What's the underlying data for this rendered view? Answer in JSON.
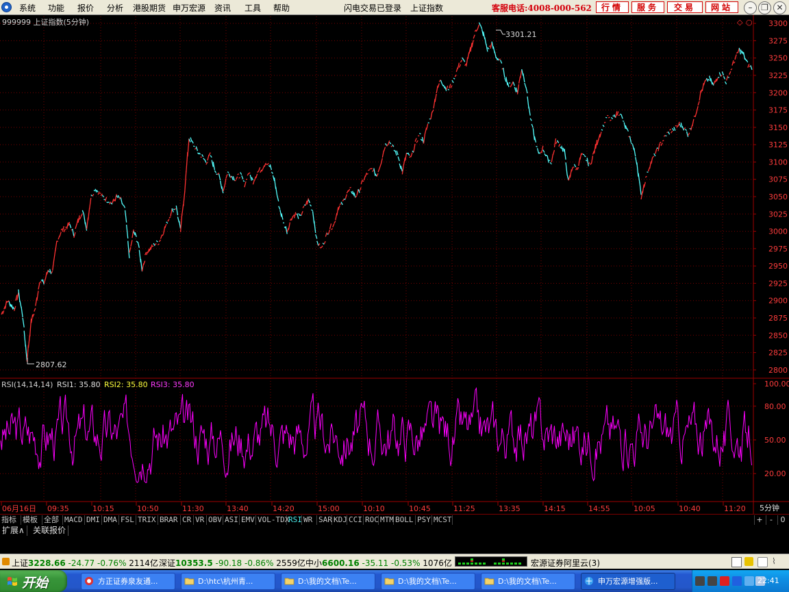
{
  "menubar": {
    "items": [
      "系统",
      "功能",
      "报价",
      "分析",
      "港股期货",
      "申万宏源",
      "资讯",
      "工具",
      "帮助"
    ],
    "status": "闪电交易已登录",
    "index_name": "上证指数",
    "hotline": "客服电话:4008-000-562",
    "buttons": [
      "行情",
      "服务",
      "交易",
      "网站"
    ]
  },
  "chart": {
    "title": "999999 上证指数(5分钟)",
    "high_label": "3301.21",
    "low_label": "2807.62",
    "price_ticks": [
      "3300",
      "3275",
      "3250",
      "3225",
      "3200",
      "3175",
      "3150",
      "3125",
      "3100",
      "3075",
      "3050",
      "3025",
      "3000",
      "2975",
      "2950",
      "2925",
      "2900",
      "2875",
      "2850",
      "2825",
      "2800"
    ],
    "rsi_header": {
      "name": "RSI(14,14,14)",
      "rsi1": "RSI1: 35.80",
      "rsi2": "RSI2: 35.80",
      "rsi3": "RSI3: 35.80"
    },
    "rsi_ticks": [
      "100.00",
      "80.00",
      "50.00",
      "20.00"
    ],
    "time_labels": [
      "06月16日",
      "09:35",
      "10:15",
      "10:50",
      "11:30",
      "13:40",
      "14:20",
      "15:00",
      "10:10",
      "10:45",
      "11:25",
      "13:35",
      "14:15",
      "14:55",
      "10:05",
      "10:40",
      "11:20"
    ],
    "period": "5分钟",
    "colors": {
      "up": "#ff3232",
      "down": "#54ffff",
      "rsi": "#ff00ff",
      "grid": "#7a0000",
      "rsi2": "#ffff00"
    }
  },
  "chart_data": {
    "type": "line",
    "series": [
      {
        "name": "RSI1",
        "value": 35.8
      },
      {
        "name": "RSI2",
        "value": 35.8
      },
      {
        "name": "RSI3",
        "value": 35.8
      }
    ],
    "price_high": 3301.21,
    "price_low": 2807.62,
    "ylim_price": [
      2790,
      3310
    ],
    "ylim_rsi": [
      0,
      100
    ],
    "price_path": [
      [
        0,
        2880
      ],
      [
        3,
        2900
      ],
      [
        6,
        2888
      ],
      [
        8,
        2912
      ],
      [
        10,
        2878
      ],
      [
        12,
        2815
      ],
      [
        14,
        2870
      ],
      [
        16,
        2890
      ],
      [
        18,
        2930
      ],
      [
        20,
        2925
      ],
      [
        22,
        2945
      ],
      [
        24,
        2940
      ],
      [
        26,
        2985
      ],
      [
        28,
        3000
      ],
      [
        30,
        3005
      ],
      [
        32,
        3010
      ],
      [
        34,
        2995
      ],
      [
        36,
        3015
      ],
      [
        38,
        3030
      ],
      [
        40,
        3005
      ],
      [
        42,
        3050
      ],
      [
        44,
        3062
      ],
      [
        46,
        3055
      ],
      [
        48,
        3048
      ],
      [
        50,
        3045
      ],
      [
        52,
        3040
      ],
      [
        54,
        3050
      ],
      [
        56,
        3045
      ],
      [
        58,
        3030
      ],
      [
        60,
        2965
      ],
      [
        62,
        3000
      ],
      [
        64,
        2985
      ],
      [
        66,
        2945
      ],
      [
        68,
        2970
      ],
      [
        70,
        2975
      ],
      [
        72,
        2982
      ],
      [
        74,
        2985
      ],
      [
        76,
        3000
      ],
      [
        78,
        3015
      ],
      [
        80,
        3030
      ],
      [
        82,
        3035
      ],
      [
        84,
        3000
      ],
      [
        86,
        3060
      ],
      [
        88,
        3135
      ],
      [
        90,
        3125
      ],
      [
        92,
        3115
      ],
      [
        94,
        3108
      ],
      [
        96,
        3100
      ],
      [
        98,
        3110
      ],
      [
        100,
        3090
      ],
      [
        102,
        3080
      ],
      [
        104,
        3058
      ],
      [
        106,
        3085
      ],
      [
        108,
        3080
      ],
      [
        110,
        3075
      ],
      [
        112,
        3082
      ],
      [
        114,
        3068
      ],
      [
        116,
        3085
      ],
      [
        118,
        3072
      ],
      [
        120,
        3085
      ],
      [
        122,
        3090
      ],
      [
        124,
        3100
      ],
      [
        126,
        3093
      ],
      [
        128,
        3075
      ],
      [
        130,
        3040
      ],
      [
        132,
        3015
      ],
      [
        134,
        3000
      ],
      [
        136,
        3020
      ],
      [
        138,
        3025
      ],
      [
        140,
        3020
      ],
      [
        142,
        3035
      ],
      [
        144,
        3045
      ],
      [
        146,
        3030
      ],
      [
        148,
        2985
      ],
      [
        150,
        2975
      ],
      [
        152,
        2990
      ],
      [
        154,
        3005
      ],
      [
        156,
        3010
      ],
      [
        158,
        3035
      ],
      [
        160,
        3040
      ],
      [
        162,
        3055
      ],
      [
        164,
        3060
      ],
      [
        166,
        3050
      ],
      [
        168,
        3060
      ],
      [
        170,
        3075
      ],
      [
        172,
        3085
      ],
      [
        174,
        3090
      ],
      [
        176,
        3080
      ],
      [
        178,
        3100
      ],
      [
        180,
        3125
      ],
      [
        182,
        3130
      ],
      [
        184,
        3118
      ],
      [
        186,
        3110
      ],
      [
        188,
        3085
      ],
      [
        190,
        3112
      ],
      [
        192,
        3105
      ],
      [
        194,
        3125
      ],
      [
        196,
        3140
      ],
      [
        198,
        3130
      ],
      [
        200,
        3155
      ],
      [
        202,
        3170
      ],
      [
        204,
        3200
      ],
      [
        206,
        3220
      ],
      [
        208,
        3208
      ],
      [
        210,
        3205
      ],
      [
        212,
        3218
      ],
      [
        214,
        3235
      ],
      [
        216,
        3248
      ],
      [
        218,
        3240
      ],
      [
        220,
        3262
      ],
      [
        222,
        3285
      ],
      [
        224,
        3300
      ],
      [
        226,
        3285
      ],
      [
        228,
        3262
      ],
      [
        230,
        3270
      ],
      [
        232,
        3252
      ],
      [
        234,
        3245
      ],
      [
        236,
        3225
      ],
      [
        238,
        3210
      ],
      [
        240,
        3215
      ],
      [
        242,
        3200
      ],
      [
        244,
        3235
      ],
      [
        246,
        3210
      ],
      [
        248,
        3165
      ],
      [
        250,
        3135
      ],
      [
        252,
        3110
      ],
      [
        254,
        3120
      ],
      [
        256,
        3105
      ],
      [
        258,
        3100
      ],
      [
        260,
        3130
      ],
      [
        262,
        3125
      ],
      [
        264,
        3115
      ],
      [
        266,
        3070
      ],
      [
        268,
        3095
      ],
      [
        270,
        3090
      ],
      [
        272,
        3110
      ],
      [
        274,
        3105
      ],
      [
        276,
        3095
      ],
      [
        278,
        3115
      ],
      [
        280,
        3135
      ],
      [
        282,
        3150
      ],
      [
        284,
        3165
      ],
      [
        286,
        3160
      ],
      [
        288,
        3168
      ],
      [
        290,
        3172
      ],
      [
        292,
        3155
      ],
      [
        294,
        3140
      ],
      [
        296,
        3125
      ],
      [
        298,
        3100
      ],
      [
        300,
        3050
      ],
      [
        302,
        3075
      ],
      [
        304,
        3095
      ],
      [
        306,
        3108
      ],
      [
        308,
        3120
      ],
      [
        310,
        3130
      ],
      [
        312,
        3140
      ],
      [
        314,
        3145
      ],
      [
        316,
        3148
      ],
      [
        318,
        3155
      ],
      [
        320,
        3150
      ],
      [
        322,
        3140
      ],
      [
        324,
        3155
      ],
      [
        326,
        3175
      ],
      [
        328,
        3200
      ],
      [
        330,
        3215
      ],
      [
        332,
        3220
      ],
      [
        334,
        3210
      ],
      [
        336,
        3225
      ],
      [
        338,
        3228
      ],
      [
        340,
        3215
      ],
      [
        342,
        3232
      ],
      [
        344,
        3248
      ],
      [
        346,
        3262
      ],
      [
        348,
        3255
      ],
      [
        350,
        3240
      ],
      [
        352,
        3236
      ]
    ],
    "rsi_path_note": "oscillating around 50 with range ~15–95"
  },
  "tabs": [
    "指标",
    "模板",
    "全部",
    "MACD",
    "DMI",
    "DMA",
    "FSL",
    "TRIX",
    "BRAR",
    "CR",
    "VR",
    "OBV",
    "ASI",
    "EMV",
    "VOL-TDX",
    "RSI",
    "WR",
    "SAR",
    "KDJ",
    "CCI",
    "ROC",
    "MTM",
    "BOLL",
    "PSY",
    "MCST"
  ],
  "tab_controls": [
    "+",
    "-",
    "0"
  ],
  "subtabs": [
    "扩展∧",
    "关联报价"
  ],
  "ticker": {
    "sh_label": "上证",
    "sh_value": "3228.66",
    "sh_change": "-24.77",
    "sh_pct": "-0.76%",
    "sh_amount": "2114亿",
    "sz_label": "深证",
    "sz_value": "10353.5",
    "sz_change": "-90.18",
    "sz_pct": "-0.86%",
    "sz_amount": "2559亿",
    "zx_label": "中小",
    "zx_value": "6600.16",
    "zx_change": "-35.11",
    "zx_pct": "-0.53%",
    "zx_amount": "1076亿",
    "server": "宏源证券阿里云(3)"
  },
  "taskbar": {
    "start": "开始",
    "tasks": [
      "方正证券泉友通...",
      "D:\\htc\\杭州青...",
      "D:\\我的文档\\Te...",
      "D:\\我的文档\\Te...",
      "D:\\我的文档\\Te...",
      "申万宏源增强版..."
    ],
    "clock": "22:41"
  }
}
